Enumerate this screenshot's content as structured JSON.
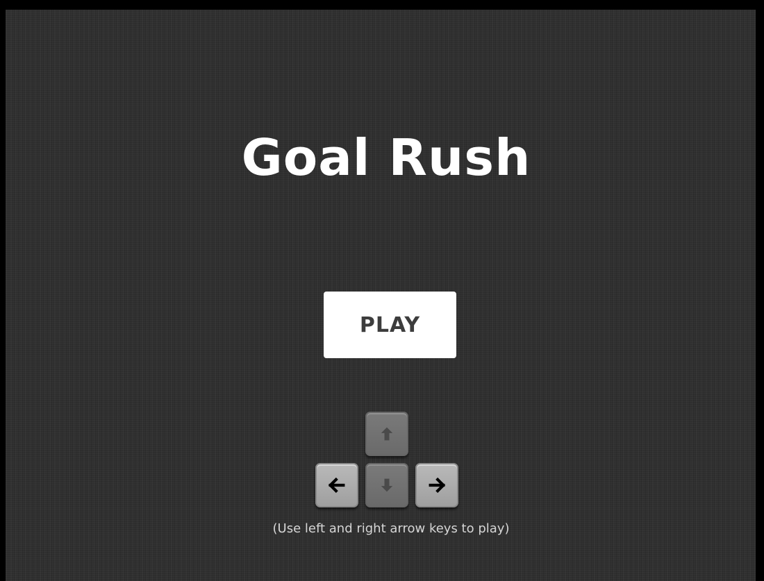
{
  "game": {
    "title": "Goal Rush",
    "play_label": "PLAY",
    "instructions": "(Use left and right arrow keys to play)"
  },
  "keys": [
    {
      "name": "up",
      "icon": "arrow-up-icon",
      "enabled": false
    },
    {
      "name": "left",
      "icon": "arrow-left-icon",
      "enabled": true
    },
    {
      "name": "down",
      "icon": "arrow-down-icon",
      "enabled": false
    },
    {
      "name": "right",
      "icon": "arrow-right-icon",
      "enabled": true
    }
  ],
  "colors": {
    "background": "#2f2f2f",
    "title": "#ffffff",
    "play_button_bg": "#ffffff",
    "play_button_text": "#3d3d3d",
    "instructions": "#d6d6d6"
  }
}
